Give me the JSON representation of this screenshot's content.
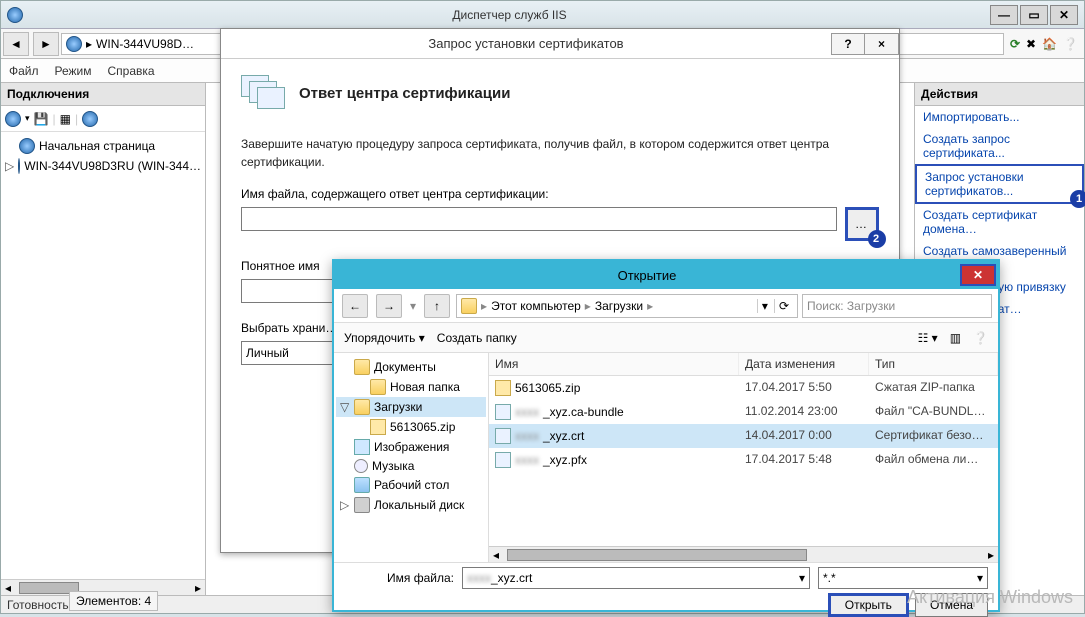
{
  "iis": {
    "title": "Диспетчер служб IIS",
    "address": "WIN-344VU98D…",
    "menu": {
      "file": "Файл",
      "mode": "Режим",
      "help": "Справка"
    },
    "connections_header": "Подключения",
    "tree": {
      "start_page": "Начальная страница",
      "server": "WIN-344VU98D3RU (WIN-344…"
    },
    "status": "Готовность",
    "elements": "Элементов: 4"
  },
  "actions": {
    "header": "Действия",
    "import": "Импортировать...",
    "create_request": "Создать запрос сертификата...",
    "install_request": "Запрос установки сертификатов...",
    "domain_cert": "Создать сертификат домена…",
    "self_signed": "Создать самозаверенный сертификат...",
    "auto_bind1": "отматическую привязку",
    "auto_bind2": "х сертификат…"
  },
  "cert_dialog": {
    "title": "Запрос установки сертификатов",
    "heading": "Ответ центра сертификации",
    "description": "Завершите начатую процедуру запроса сертификата, получив файл, в котором содержится ответ центра сертификации.",
    "file_label": "Имя файла, содержащего ответ центра сертификации:",
    "browse": "…",
    "friendly_label": "Понятное имя",
    "store_label": "Выбрать храни…",
    "store_value": "Личный",
    "help_btn": "?",
    "close_btn": "×"
  },
  "open_dialog": {
    "title": "Открытие",
    "crumbs": {
      "pc": "Этот компьютер",
      "downloads": "Загрузки"
    },
    "search_placeholder": "Поиск: Загрузки",
    "organize": "Упорядочить",
    "new_folder": "Создать папку",
    "columns": {
      "name": "Имя",
      "date": "Дата изменения",
      "type": "Тип"
    },
    "left_tree": {
      "documents": "Документы",
      "new_folder": "Новая папка",
      "downloads": "Загрузки",
      "zip": "5613065.zip",
      "pictures": "Изображения",
      "music": "Музыка",
      "desktop": "Рабочий стол",
      "local_disk": "Локальный диск"
    },
    "files": [
      {
        "name": "5613065.zip",
        "date": "17.04.2017 5:50",
        "type": "Сжатая ZIP-папка",
        "icon": "zip"
      },
      {
        "name": "_xyz.ca-bundle",
        "date": "11.02.2014 23:00",
        "type": "Файл \"CA-BUNDL…",
        "icon": "cert",
        "blur": true
      },
      {
        "name": "_xyz.crt",
        "date": "14.04.2017 0:00",
        "type": "Сертификат безо…",
        "icon": "cert",
        "blur": true,
        "selected": true
      },
      {
        "name": "_xyz.pfx",
        "date": "17.04.2017 5:48",
        "type": "Файл обмена ли…",
        "icon": "cert",
        "blur": true
      }
    ],
    "filename_label": "Имя файла:",
    "filename_value": "_xyz.crt",
    "filter": "*.*",
    "open_btn": "Открыть",
    "cancel_btn": "Отмена"
  },
  "annotations": {
    "one": "1",
    "two": "2"
  },
  "watermark": "Активация Windows"
}
